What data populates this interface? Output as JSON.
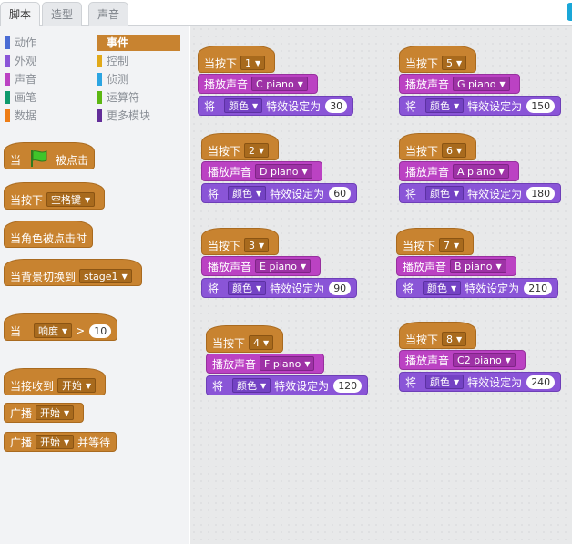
{
  "tabs": [
    {
      "label": "脚本"
    },
    {
      "label": "造型"
    },
    {
      "label": "声音"
    }
  ],
  "categories": {
    "left": [
      {
        "label": "动作",
        "color": "#4a6cd4"
      },
      {
        "label": "外观",
        "color": "#8a55d7"
      },
      {
        "label": "声音",
        "color": "#bb42c3"
      },
      {
        "label": "画笔",
        "color": "#0e9a6c"
      },
      {
        "label": "数据",
        "color": "#ee7d16"
      }
    ],
    "right": [
      {
        "label": "事件",
        "color": "#c88330"
      },
      {
        "label": "控制",
        "color": "#e1a91a"
      },
      {
        "label": "侦测",
        "color": "#2ca5e2"
      },
      {
        "label": "运算符",
        "color": "#5cb712"
      },
      {
        "label": "更多模块",
        "color": "#632d99"
      }
    ]
  },
  "palette_blocks": {
    "when_flag": {
      "text1": "当",
      "text2": "被点击"
    },
    "when_key": {
      "text": "当按下",
      "key": "空格键"
    },
    "when_sprite_clicked": {
      "text": "当角色被点击时"
    },
    "when_backdrop": {
      "text": "当背景切换到",
      "value": "stage1"
    },
    "when_sensor": {
      "text": "当",
      "sensor": "响度",
      "op": ">",
      "value": "10"
    },
    "when_receive": {
      "text": "当接收到",
      "value": "开始"
    },
    "broadcast": {
      "text": "广播",
      "value": "开始"
    },
    "broadcast_wait": {
      "text": "广播",
      "value": "开始",
      "suffix": "并等待"
    }
  },
  "scripts": [
    {
      "hat": "当按下",
      "key": "1",
      "play": "播放声音",
      "sound": "C piano",
      "set": "将",
      "effect": "颜色",
      "to": "特效设定为",
      "value": "30"
    },
    {
      "hat": "当按下",
      "key": "2",
      "play": "播放声音",
      "sound": "D piano",
      "set": "将",
      "effect": "颜色",
      "to": "特效设定为",
      "value": "60"
    },
    {
      "hat": "当按下",
      "key": "3",
      "play": "播放声音",
      "sound": "E piano",
      "set": "将",
      "effect": "颜色",
      "to": "特效设定为",
      "value": "90"
    },
    {
      "hat": "当按下",
      "key": "4",
      "play": "播放声音",
      "sound": "F piano",
      "set": "将",
      "effect": "颜色",
      "to": "特效设定为",
      "value": "120"
    },
    {
      "hat": "当按下",
      "key": "5",
      "play": "播放声音",
      "sound": "G piano",
      "set": "将",
      "effect": "颜色",
      "to": "特效设定为",
      "value": "150"
    },
    {
      "hat": "当按下",
      "key": "6",
      "play": "播放声音",
      "sound": "A piano",
      "set": "将",
      "effect": "颜色",
      "to": "特效设定为",
      "value": "180"
    },
    {
      "hat": "当按下",
      "key": "7",
      "play": "播放声音",
      "sound": "B piano",
      "set": "将",
      "effect": "颜色",
      "to": "特效设定为",
      "value": "210"
    },
    {
      "hat": "当按下",
      "key": "8",
      "play": "播放声音",
      "sound": "C2 piano",
      "set": "将",
      "effect": "颜色",
      "to": "特效设定为",
      "value": "240"
    }
  ]
}
